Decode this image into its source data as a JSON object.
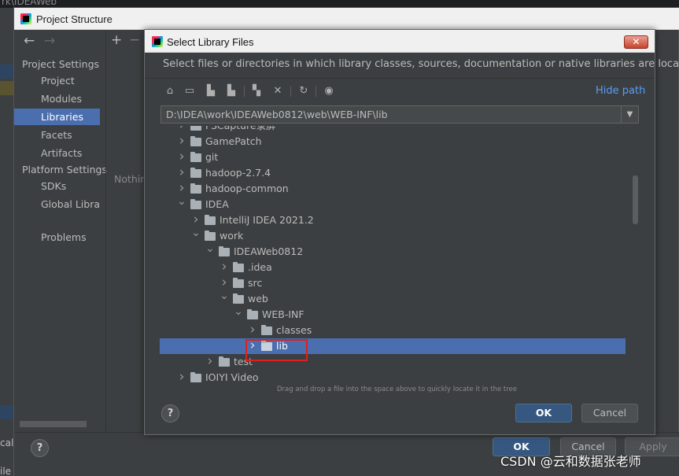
{
  "background": {
    "title_fragment": "rk\\IDEAWeb",
    "left_text_1": "cal",
    "left_text_2": "ile"
  },
  "project_structure": {
    "title": "Project Structure",
    "section_project_settings": "Project Settings",
    "project_items": [
      "Project",
      "Modules",
      "Libraries",
      "Facets",
      "Artifacts"
    ],
    "section_platform_settings": "Platform Settings",
    "platform_items": [
      "SDKs",
      "Global Librar"
    ],
    "problems": "Problems",
    "selected_item": "Libraries",
    "nothing_text": "Nothin",
    "ok_label": "OK",
    "cancel_label": "Cancel",
    "apply_label": "Apply",
    "help_label": "?"
  },
  "dialog": {
    "title": "Select Library Files",
    "close_label": "✕",
    "description": "Select files or directories in which library classes, sources, documentation or native libraries are located",
    "hide_path_label": "Hide path",
    "path_value": "D:\\IDEA\\work\\IDEAWeb0812\\web\\WEB-INF\\lib",
    "tree": [
      {
        "label": "FSCapture录屏",
        "depth": 0,
        "expanded": false
      },
      {
        "label": "GamePatch",
        "depth": 0,
        "expanded": false
      },
      {
        "label": "git",
        "depth": 0,
        "expanded": false
      },
      {
        "label": "hadoop-2.7.4",
        "depth": 0,
        "expanded": false
      },
      {
        "label": "hadoop-common",
        "depth": 0,
        "expanded": false
      },
      {
        "label": "IDEA",
        "depth": 0,
        "expanded": true
      },
      {
        "label": "IntelliJ IDEA 2021.2",
        "depth": 1,
        "expanded": false
      },
      {
        "label": "work",
        "depth": 1,
        "expanded": true
      },
      {
        "label": "IDEAWeb0812",
        "depth": 2,
        "expanded": true
      },
      {
        "label": ".idea",
        "depth": 3,
        "expanded": false
      },
      {
        "label": "src",
        "depth": 3,
        "expanded": false
      },
      {
        "label": "web",
        "depth": 3,
        "expanded": true
      },
      {
        "label": "WEB-INF",
        "depth": 4,
        "expanded": true
      },
      {
        "label": "classes",
        "depth": 5,
        "expanded": false
      },
      {
        "label": "lib",
        "depth": 5,
        "expanded": false,
        "selected": true
      },
      {
        "label": "test",
        "depth": 2,
        "expanded": false
      },
      {
        "label": "IOIYI Video",
        "depth": 0,
        "expanded": false
      }
    ],
    "hint": "Drag and drop a file into the space above to quickly locate it in the tree",
    "ok_label": "OK",
    "cancel_label": "Cancel",
    "help_label": "?"
  },
  "watermark": "CSDN @云和数据张老师",
  "colors": {
    "selection": "#4b6eaf",
    "link": "#589df6",
    "highlight_box": "#e0201e",
    "primary_button": "#365880"
  }
}
